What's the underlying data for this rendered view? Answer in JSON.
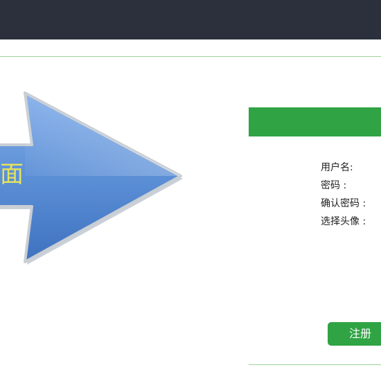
{
  "banner": {
    "arrow_text": "面"
  },
  "register_form": {
    "fields": [
      {
        "label": "用户名:"
      },
      {
        "label": "密码 :"
      },
      {
        "label": "确认密码 :"
      },
      {
        "label": "选择头像 :"
      }
    ],
    "register_label": "注册"
  },
  "colors": {
    "top_bar": "#2b303c",
    "accent_green": "#30a444",
    "divider": "#9ad39a",
    "arrow_fill": "#5b8fd6",
    "arrow_text": "#e6e35a"
  },
  "icons": {
    "arrow": "right-arrow-icon"
  }
}
